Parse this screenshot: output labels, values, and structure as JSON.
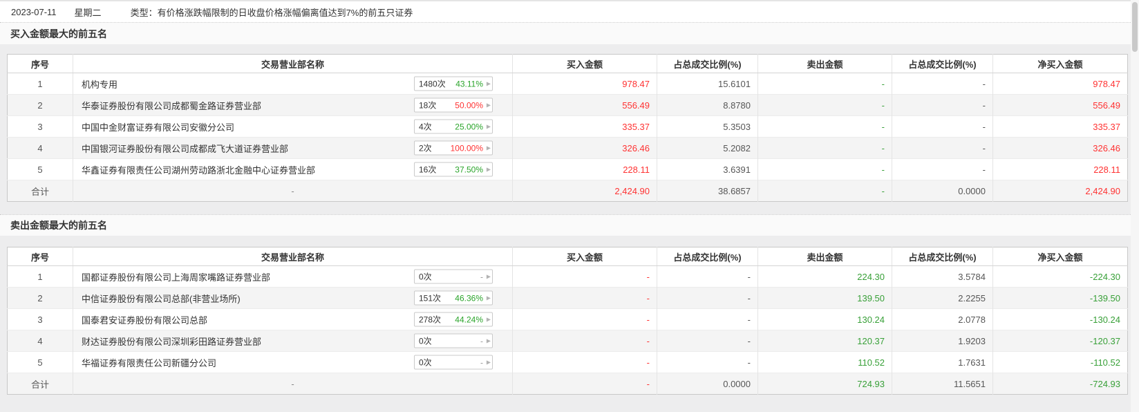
{
  "topbar": {
    "date": "2023-07-11",
    "weekday": "星期二",
    "type_text": "类型：有价格涨跌幅限制的日收盘价格涨幅偏离值达到7%的前五只证券"
  },
  "colors": {
    "up_red": "#ff3232",
    "down_green": "#38a038",
    "neutral_gray": "#565656"
  },
  "sections": [
    {
      "title": "买入金额最大的前五名",
      "columns": [
        "序号",
        "交易营业部名称",
        "买入金额",
        "占总成交比例(%)",
        "卖出金额",
        "占总成交比例(%)",
        "净买入金额"
      ],
      "rows": [
        {
          "seq": "1",
          "name": "机构专用",
          "badge_count": "1480次",
          "badge_pct": "43.11%",
          "badge_pct_class": "green",
          "buy": "978.47",
          "buy_ratio": "15.6101",
          "sell": "-",
          "sell_ratio": "-",
          "net": "978.47"
        },
        {
          "seq": "2",
          "name": "华泰证券股份有限公司成都蜀金路证券营业部",
          "badge_count": "18次",
          "badge_pct": "50.00%",
          "badge_pct_class": "red",
          "buy": "556.49",
          "buy_ratio": "8.8780",
          "sell": "-",
          "sell_ratio": "-",
          "net": "556.49"
        },
        {
          "seq": "3",
          "name": "中国中金财富证券有限公司安徽分公司",
          "badge_count": "4次",
          "badge_pct": "25.00%",
          "badge_pct_class": "green",
          "buy": "335.37",
          "buy_ratio": "5.3503",
          "sell": "-",
          "sell_ratio": "-",
          "net": "335.37"
        },
        {
          "seq": "4",
          "name": "中国银河证券股份有限公司成都成飞大道证券营业部",
          "badge_count": "2次",
          "badge_pct": "100.00%",
          "badge_pct_class": "red",
          "buy": "326.46",
          "buy_ratio": "5.2082",
          "sell": "-",
          "sell_ratio": "-",
          "net": "326.46"
        },
        {
          "seq": "5",
          "name": "华鑫证券有限责任公司湖州劳动路浙北金融中心证券营业部",
          "badge_count": "16次",
          "badge_pct": "37.50%",
          "badge_pct_class": "green",
          "buy": "228.11",
          "buy_ratio": "3.6391",
          "sell": "-",
          "sell_ratio": "-",
          "net": "228.11"
        }
      ],
      "total": {
        "label": "合计",
        "name": "-",
        "buy": "2,424.90",
        "buy_ratio": "38.6857",
        "sell": "-",
        "sell_ratio": "0.0000",
        "net": "2,424.90"
      }
    },
    {
      "title": "卖出金额最大的前五名",
      "columns": [
        "序号",
        "交易营业部名称",
        "买入金额",
        "占总成交比例(%)",
        "卖出金额",
        "占总成交比例(%)",
        "净买入金额"
      ],
      "rows": [
        {
          "seq": "1",
          "name": "国都证券股份有限公司上海周家嘴路证券营业部",
          "badge_count": "0次",
          "badge_pct": "-",
          "badge_pct_class": "gray",
          "buy": "-",
          "buy_ratio": "-",
          "sell": "224.30",
          "sell_ratio": "3.5784",
          "net": "-224.30"
        },
        {
          "seq": "2",
          "name": "中信证券股份有限公司总部(非营业场所)",
          "badge_count": "151次",
          "badge_pct": "46.36%",
          "badge_pct_class": "green",
          "buy": "-",
          "buy_ratio": "-",
          "sell": "139.50",
          "sell_ratio": "2.2255",
          "net": "-139.50"
        },
        {
          "seq": "3",
          "name": "国泰君安证券股份有限公司总部",
          "badge_count": "278次",
          "badge_pct": "44.24%",
          "badge_pct_class": "green",
          "buy": "-",
          "buy_ratio": "-",
          "sell": "130.24",
          "sell_ratio": "2.0778",
          "net": "-130.24"
        },
        {
          "seq": "4",
          "name": "财达证券股份有限公司深圳彩田路证券营业部",
          "badge_count": "0次",
          "badge_pct": "-",
          "badge_pct_class": "gray",
          "buy": "-",
          "buy_ratio": "-",
          "sell": "120.37",
          "sell_ratio": "1.9203",
          "net": "-120.37"
        },
        {
          "seq": "5",
          "name": "华福证券有限责任公司新疆分公司",
          "badge_count": "0次",
          "badge_pct": "-",
          "badge_pct_class": "gray",
          "buy": "-",
          "buy_ratio": "-",
          "sell": "110.52",
          "sell_ratio": "1.7631",
          "net": "-110.52"
        }
      ],
      "total": {
        "label": "合计",
        "name": "-",
        "buy": "-",
        "buy_ratio": "0.0000",
        "sell": "724.93",
        "sell_ratio": "11.5651",
        "net": "-724.93"
      }
    }
  ],
  "icons": {
    "expand_arrow": "▶"
  }
}
